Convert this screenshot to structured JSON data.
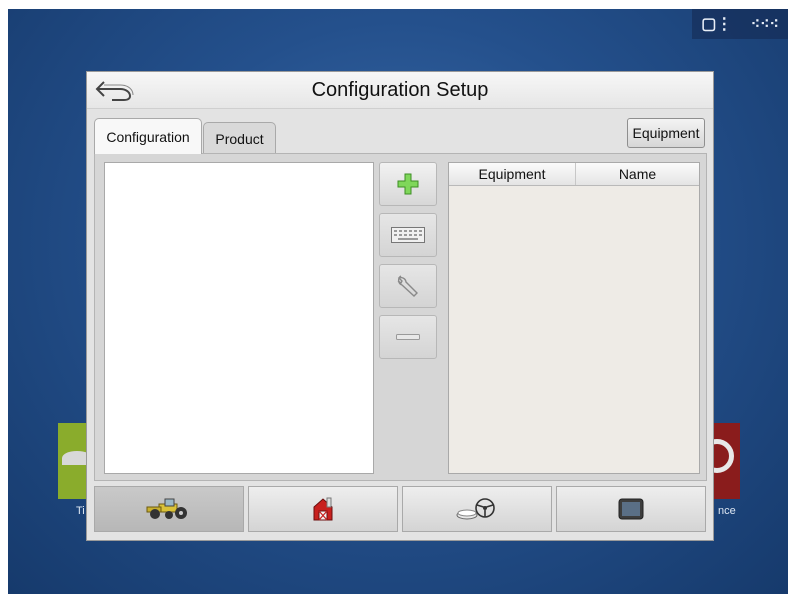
{
  "dialog": {
    "title": "Configuration Setup",
    "back_icon": "back-arrow-icon"
  },
  "tabs": [
    {
      "label": "Configuration",
      "active": true
    },
    {
      "label": "Product",
      "active": false
    }
  ],
  "equipment_button": {
    "label": "Equipment"
  },
  "actions": [
    {
      "name": "add",
      "icon": "plus-icon",
      "color": "#5cc43a"
    },
    {
      "name": "rename",
      "icon": "keyboard-icon"
    },
    {
      "name": "edit",
      "icon": "wrench-icon"
    },
    {
      "name": "remove",
      "icon": "minus-icon"
    }
  ],
  "equipment_table": {
    "columns": [
      "Equipment",
      "Name"
    ],
    "rows": []
  },
  "bottom_tabs": [
    {
      "name": "equipment",
      "icon": "tractor-icon",
      "selected": true
    },
    {
      "name": "farm",
      "icon": "barn-icon",
      "selected": false
    },
    {
      "name": "guidance",
      "icon": "steering-wheel-icon",
      "selected": false
    },
    {
      "name": "display",
      "icon": "display-icon",
      "selected": false
    }
  ],
  "background": {
    "left_label": "Ti",
    "right_label": "nce"
  },
  "colors": {
    "accent_green": "#5cc43a",
    "barn_red": "#c8201e",
    "background_blue": "#24508c"
  }
}
